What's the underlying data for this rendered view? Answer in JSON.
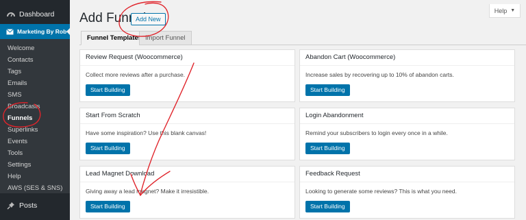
{
  "sidebar": {
    "dashboard_label": "Dashboard",
    "active_plugin_label": "Marketing By Rob",
    "items": [
      {
        "label": "Welcome"
      },
      {
        "label": "Contacts"
      },
      {
        "label": "Tags"
      },
      {
        "label": "Emails"
      },
      {
        "label": "SMS"
      },
      {
        "label": "Broadcasts"
      },
      {
        "label": "Funnels"
      },
      {
        "label": "Superlinks"
      },
      {
        "label": "Events"
      },
      {
        "label": "Tools"
      },
      {
        "label": "Settings"
      },
      {
        "label": "Help"
      },
      {
        "label": "AWS (SES & SNS)"
      }
    ],
    "posts_label": "Posts"
  },
  "header": {
    "title": "Add Funnel",
    "add_new_label": "Add New",
    "help_label": "Help"
  },
  "tabs": [
    {
      "label": "Funnel Templates",
      "active": true
    },
    {
      "label": "Import Funnel",
      "active": false
    }
  ],
  "cards": [
    {
      "title": "Review Request (Woocommerce)",
      "desc": "Collect more reviews after a purchase.",
      "button": "Start Building"
    },
    {
      "title": "Abandon Cart (Woocommerce)",
      "desc": "Increase sales by recovering up to 10% of abandon carts.",
      "button": "Start Building"
    },
    {
      "title": "Start From Scratch",
      "desc": "Have some inspiration? Use this blank canvas!",
      "button": "Start Building"
    },
    {
      "title": "Login Abandonment",
      "desc": "Remind your subscribers to login every once in a while.",
      "button": "Start Building"
    },
    {
      "title": "Lead Magnet Download",
      "desc": "Giving away a lead magnet? Make it irresistible.",
      "button": "Start Building"
    },
    {
      "title": "Feedback Request",
      "desc": "Looking to generate some reviews? This is what you need.",
      "button": "Start Building"
    }
  ],
  "colors": {
    "accent": "#0073aa",
    "sidebar_bg": "#23282d",
    "annotation": "#e0242b"
  }
}
